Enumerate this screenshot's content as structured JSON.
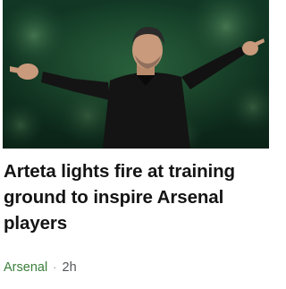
{
  "article": {
    "image_alt": "",
    "headline": "Arteta lights fire at training ground to inspire Arsenal players",
    "topic": "Arsenal",
    "separator": "·",
    "time_ago": "2h"
  },
  "colors": {
    "topic": "#3a7f3a",
    "headline": "#141414",
    "meta": "#545658"
  }
}
